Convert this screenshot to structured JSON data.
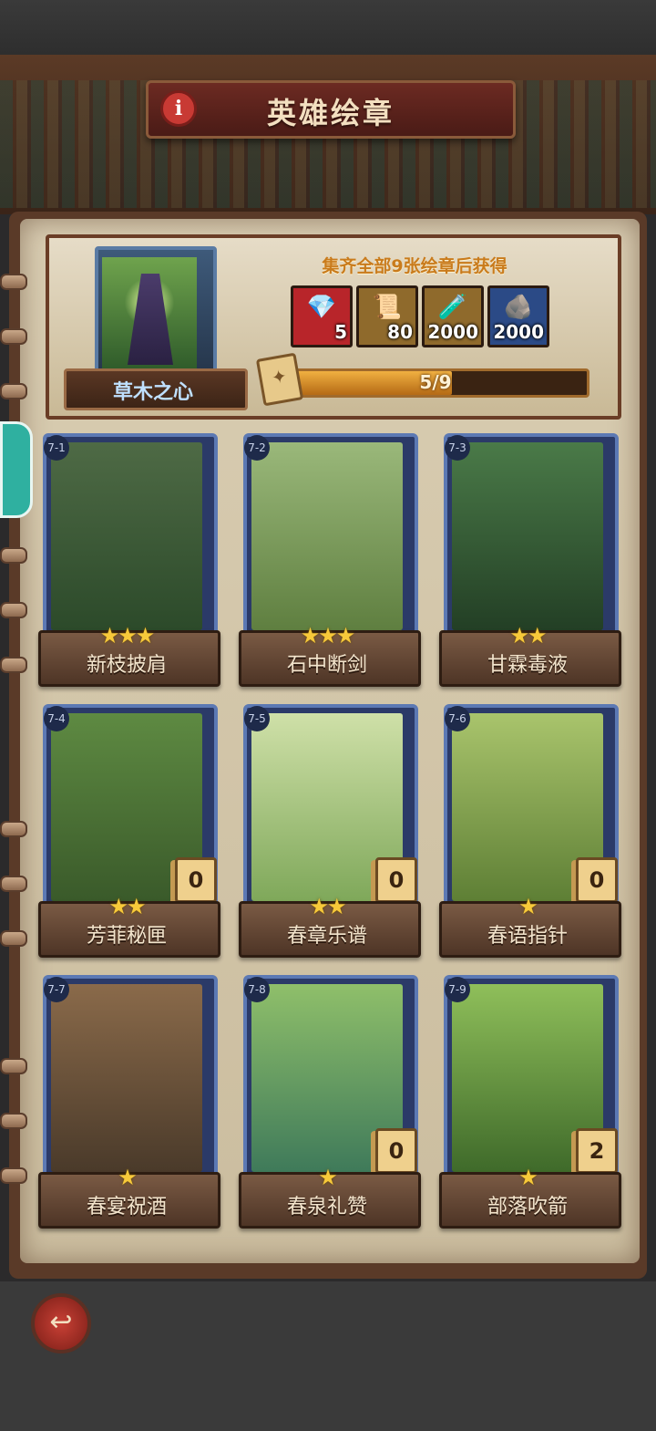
{
  "header": {
    "title": "英雄绘章",
    "info_icon": "i"
  },
  "reward": {
    "title": "集齐全部9张绘章后获得",
    "set_name": "草木之心",
    "items": [
      {
        "icon": "gem-pile-icon",
        "glyph": "💎",
        "qty": "5",
        "bg": "#b8252a"
      },
      {
        "icon": "scroll-icon",
        "glyph": "📜",
        "qty": "80",
        "bg": "#8f6a2c"
      },
      {
        "icon": "potion-icon",
        "glyph": "🧪",
        "qty": "2000",
        "bg": "#8f6a2c"
      },
      {
        "icon": "ore-icon",
        "glyph": "🪨",
        "qty": "2000",
        "bg": "#2b4a86"
      }
    ],
    "progress_text": "5/9",
    "progress_fraction": 0.5556
  },
  "cards": [
    {
      "num": "7-1",
      "name": "新枝披肩",
      "stars": "★★★",
      "count": "",
      "art": "linear-gradient(#4e6a45,#2c4a2a)"
    },
    {
      "num": "7-2",
      "name": "石中断剑",
      "stars": "★★★",
      "count": "",
      "art": "linear-gradient(#9ab87a,#5f7f40)"
    },
    {
      "num": "7-3",
      "name": "甘霖毒液",
      "stars": "★★",
      "count": "",
      "art": "linear-gradient(#4a7a48,#233f25)"
    },
    {
      "num": "7-4",
      "name": "芳菲秘匣",
      "stars": "★★",
      "count": "0",
      "art": "linear-gradient(#5e8a42,#3a5a2a)"
    },
    {
      "num": "7-5",
      "name": "春章乐谱",
      "stars": "★★",
      "count": "0",
      "art": "linear-gradient(#cfe0a8,#7fa85a)"
    },
    {
      "num": "7-6",
      "name": "春语指针",
      "stars": "★",
      "count": "0",
      "art": "linear-gradient(#a9c46c,#5e7f35)"
    },
    {
      "num": "7-7",
      "name": "春宴祝酒",
      "stars": "★",
      "count": "",
      "art": "linear-gradient(#8a6a4a,#4a3a2a)"
    },
    {
      "num": "7-8",
      "name": "春泉礼赞",
      "stars": "★",
      "count": "0",
      "art": "linear-gradient(#8fbf6a,#3f7a5a)"
    },
    {
      "num": "7-9",
      "name": "部落吹箭",
      "stars": "★",
      "count": "2",
      "art": "linear-gradient(#8fbf5a,#3f6a2a)"
    }
  ],
  "footer": {
    "back_icon": "↩"
  }
}
